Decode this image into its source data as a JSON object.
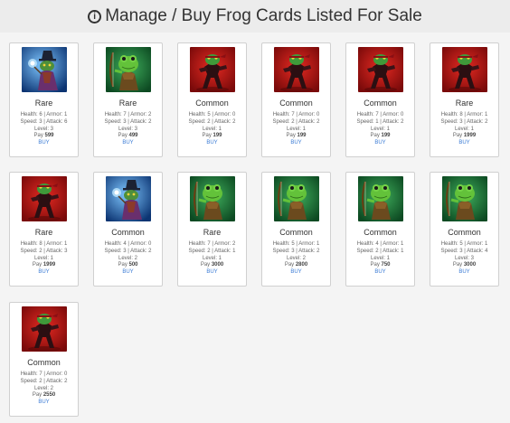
{
  "header": {
    "title": "Manage / Buy Frog Cards Listed For Sale",
    "info_icon": "info-circle-icon"
  },
  "labels": {
    "health": "Health:",
    "armor": "Armor:",
    "speed": "Speed:",
    "attack": "Attack:",
    "level": "Level:",
    "pay": "Pay",
    "buy": "BUY"
  },
  "cards": [
    {
      "rarity": "Rare",
      "health": 6,
      "armor": 1,
      "speed": 3,
      "attack": 6,
      "level": 3,
      "pay": 599,
      "art": "wizard"
    },
    {
      "rarity": "Rare",
      "health": 7,
      "armor": 2,
      "speed": 3,
      "attack": 2,
      "level": 3,
      "pay": 499,
      "art": "archer"
    },
    {
      "rarity": "Common",
      "health": 5,
      "armor": 0,
      "speed": 2,
      "attack": 2,
      "level": 1,
      "pay": 199,
      "art": "ninja"
    },
    {
      "rarity": "Common",
      "health": 7,
      "armor": 0,
      "speed": 2,
      "attack": 2,
      "level": 1,
      "pay": 199,
      "art": "ninja"
    },
    {
      "rarity": "Common",
      "health": 7,
      "armor": 0,
      "speed": 1,
      "attack": 2,
      "level": 1,
      "pay": 199,
      "art": "ninja"
    },
    {
      "rarity": "Rare",
      "health": 8,
      "armor": 1,
      "speed": 3,
      "attack": 2,
      "level": 1,
      "pay": 1999,
      "art": "ninja"
    },
    {
      "rarity": "Rare",
      "health": 8,
      "armor": 1,
      "speed": 2,
      "attack": 3,
      "level": 1,
      "pay": 1999,
      "art": "ninja"
    },
    {
      "rarity": "Common",
      "health": 4,
      "armor": 0,
      "speed": 3,
      "attack": 2,
      "level": 2,
      "pay": 500,
      "art": "wizard"
    },
    {
      "rarity": "Rare",
      "health": 7,
      "armor": 2,
      "speed": 2,
      "attack": 1,
      "level": 1,
      "pay": 3000,
      "art": "archer"
    },
    {
      "rarity": "Common",
      "health": 5,
      "armor": 1,
      "speed": 3,
      "attack": 2,
      "level": 2,
      "pay": 2800,
      "art": "archer"
    },
    {
      "rarity": "Common",
      "health": 4,
      "armor": 1,
      "speed": 2,
      "attack": 1,
      "level": 1,
      "pay": 750,
      "art": "archer"
    },
    {
      "rarity": "Common",
      "health": 5,
      "armor": 1,
      "speed": 3,
      "attack": 4,
      "level": 3,
      "pay": 3000,
      "art": "archer"
    },
    {
      "rarity": "Common",
      "health": 7,
      "armor": 0,
      "speed": 2,
      "attack": 2,
      "level": 2,
      "pay": 2550,
      "art": "ninja"
    }
  ],
  "colors": {
    "buy_link": "#3a7bd5",
    "ninja_bg": "#b31212",
    "archer_bg": "#1d7a3a",
    "wizard_bg": "#1a5fb0"
  }
}
